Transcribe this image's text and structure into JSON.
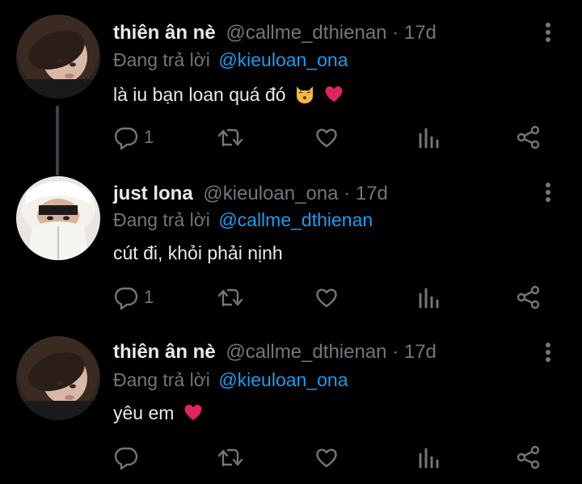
{
  "tweets": [
    {
      "name": "thiên ân nè",
      "handle": "@callme_dthienan",
      "dot": "·",
      "time": "17d",
      "reply_label": "Đang trả lời",
      "reply_to": "@kieuloan_ona",
      "text": "là iu bạn loan quá đó",
      "emojis": [
        "kissing-cat-emoji",
        "red-heart-emoji"
      ],
      "reply_count": "1"
    },
    {
      "name": "just lona",
      "handle": "@kieuloan_ona",
      "dot": "·",
      "time": "17d",
      "reply_label": "Đang trả lời",
      "reply_to": "@callme_dthienan",
      "text": "cút đi, khỏi phải nịnh",
      "emojis": [],
      "reply_count": "1"
    },
    {
      "name": "thiên ân nè",
      "handle": "@callme_dthienan",
      "dot": "·",
      "time": "17d",
      "reply_label": "Đang trả lời",
      "reply_to": "@kieuloan_ona",
      "text": "yêu em",
      "emojis": [
        "red-heart-emoji"
      ],
      "reply_count": ""
    }
  ],
  "colors": {
    "background": "#000000",
    "text": "#e7e9ea",
    "muted": "#71767b",
    "mention": "#1d9bf0",
    "thread_line": "#3d4247"
  },
  "icons": [
    "reply-icon",
    "retweet-icon",
    "like-icon",
    "stats-icon",
    "share-icon",
    "more-icon"
  ]
}
